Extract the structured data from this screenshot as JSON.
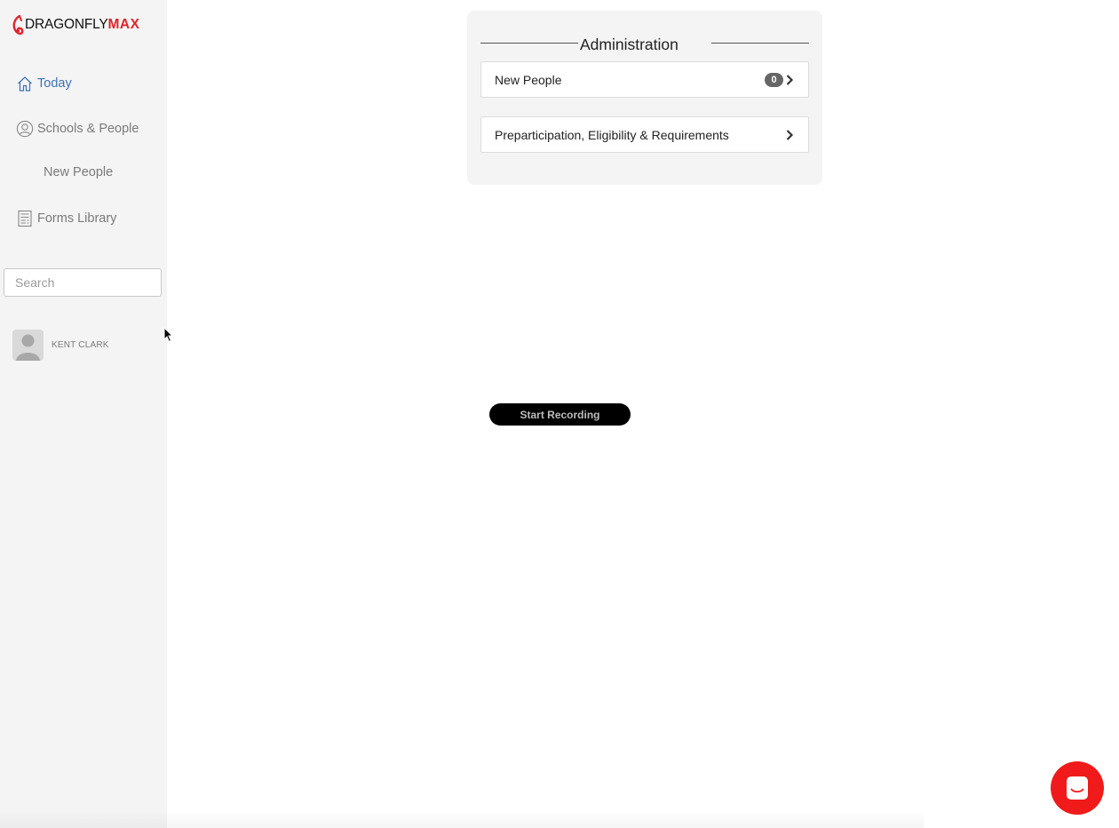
{
  "brand": {
    "word1": "DRAGONFLY",
    "word2": "MAX",
    "accent_color": "#e0232b"
  },
  "sidebar": {
    "items": [
      {
        "label": "Today",
        "icon": "home-icon",
        "active": true
      },
      {
        "label": "Schools & People",
        "icon": "user-circle-icon"
      },
      {
        "label": "New People"
      },
      {
        "label": "Forms Library",
        "icon": "document-icon"
      }
    ],
    "search": {
      "placeholder": "Search",
      "value": ""
    },
    "user": {
      "name": "KENT CLARK",
      "icon": "avatar-icon"
    }
  },
  "admin_panel": {
    "title": "Administration",
    "rows": [
      {
        "label": "New People",
        "count": "0",
        "icon": "chevron-right-icon"
      },
      {
        "label": "Preparticipation, Eligibility & Requirements",
        "icon": "chevron-right-icon"
      }
    ]
  },
  "recording": {
    "label": "Start Recording"
  },
  "chat": {
    "icon": "chat-icon",
    "color": "#f11a1a"
  },
  "colors": {
    "active_nav": "#3a73b8",
    "sidebar_bg": "#f4f4f4"
  }
}
